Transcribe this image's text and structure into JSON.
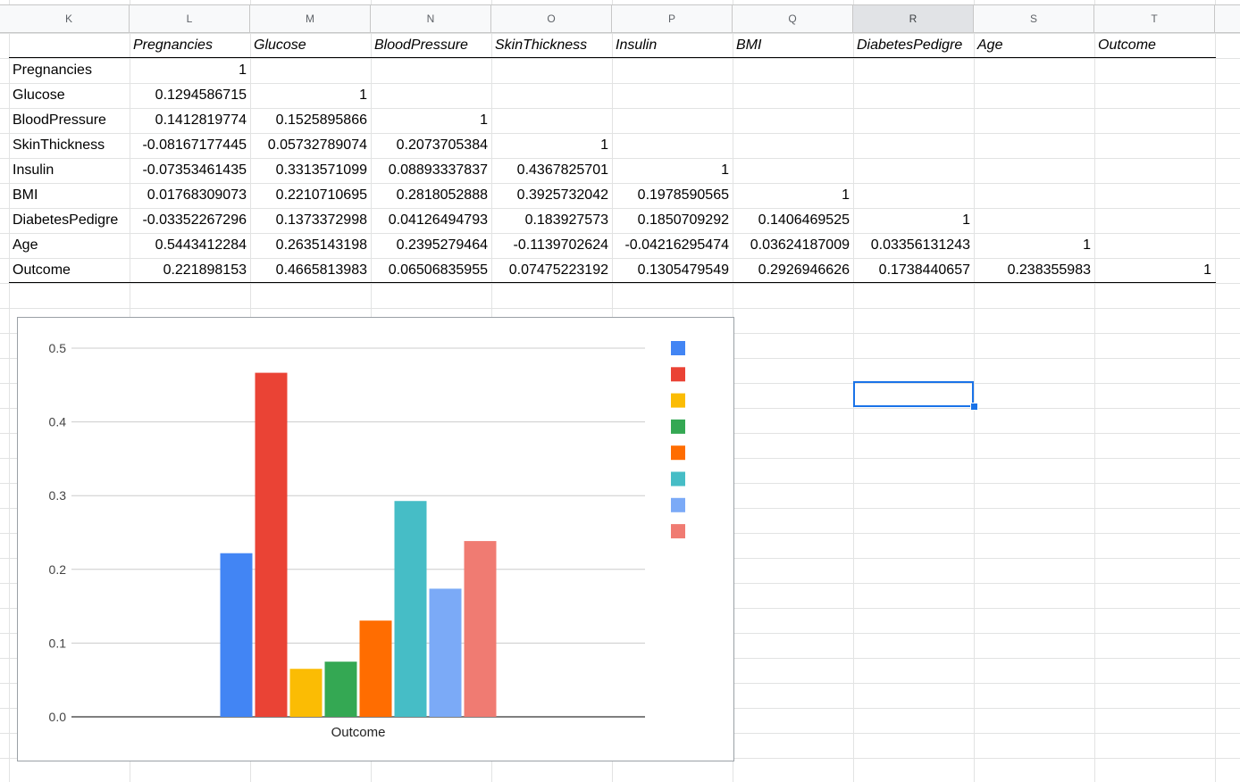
{
  "columns": [
    "K",
    "L",
    "M",
    "N",
    "O",
    "P",
    "Q",
    "R",
    "S",
    "T"
  ],
  "selected_column": "R",
  "table": {
    "headers": [
      "",
      "Pregnancies",
      "Glucose",
      "BloodPressure",
      "SkinThickness",
      "Insulin",
      "BMI",
      "DiabetesPedigre",
      "Age",
      "Outcome"
    ],
    "rows": [
      {
        "label": "Pregnancies",
        "values": [
          "1",
          "",
          "",
          "",
          "",
          "",
          "",
          "",
          ""
        ]
      },
      {
        "label": "Glucose",
        "values": [
          "0.1294586715",
          "1",
          "",
          "",
          "",
          "",
          "",
          "",
          ""
        ]
      },
      {
        "label": "BloodPressure",
        "values": [
          "0.1412819774",
          "0.1525895866",
          "1",
          "",
          "",
          "",
          "",
          "",
          ""
        ]
      },
      {
        "label": "SkinThickness",
        "values": [
          "-0.08167177445",
          "0.05732789074",
          "0.2073705384",
          "1",
          "",
          "",
          "",
          "",
          ""
        ]
      },
      {
        "label": "Insulin",
        "values": [
          "-0.07353461435",
          "0.3313571099",
          "0.08893337837",
          "0.4367825701",
          "1",
          "",
          "",
          "",
          ""
        ]
      },
      {
        "label": "BMI",
        "values": [
          "0.01768309073",
          "0.2210710695",
          "0.2818052888",
          "0.3925732042",
          "0.1978590565",
          "1",
          "",
          "",
          ""
        ]
      },
      {
        "label": "DiabetesPedigre",
        "values": [
          "-0.03352267296",
          "0.1373372998",
          "0.04126494793",
          "0.183927573",
          "0.1850709292",
          "0.1406469525",
          "1",
          "",
          ""
        ]
      },
      {
        "label": "Age",
        "values": [
          "0.5443412284",
          "0.2635143198",
          "0.2395279464",
          "-0.1139702624",
          "-0.04216295474",
          "0.03624187009",
          "0.03356131243",
          "1",
          ""
        ]
      },
      {
        "label": "Outcome",
        "values": [
          "0.221898153",
          "0.4665813983",
          "0.06506835955",
          "0.07475223192",
          "0.1305479549",
          "0.2926946626",
          "0.1738440657",
          "0.238355983",
          "1"
        ]
      }
    ]
  },
  "chart_data": {
    "type": "bar",
    "categories": [
      "Outcome"
    ],
    "series": [
      {
        "values": [
          0.2219
        ],
        "color": "#4285f4"
      },
      {
        "values": [
          0.4666
        ],
        "color": "#ea4335"
      },
      {
        "values": [
          0.0651
        ],
        "color": "#fbbc04"
      },
      {
        "values": [
          0.0748
        ],
        "color": "#34a853"
      },
      {
        "values": [
          0.1305
        ],
        "color": "#ff6d01"
      },
      {
        "values": [
          0.2927
        ],
        "color": "#46bdc6"
      },
      {
        "values": [
          0.1738
        ],
        "color": "#7baaf7"
      },
      {
        "values": [
          0.2384
        ],
        "color": "#f07b72"
      }
    ],
    "ylim": [
      0,
      0.5
    ],
    "yticks": [
      "0.0",
      "0.1",
      "0.2",
      "0.3",
      "0.4",
      "0.5"
    ],
    "grid": true,
    "legend": "right"
  },
  "colors": {
    "selection": "#1a73e8",
    "gridline": "#e2e3e3"
  }
}
